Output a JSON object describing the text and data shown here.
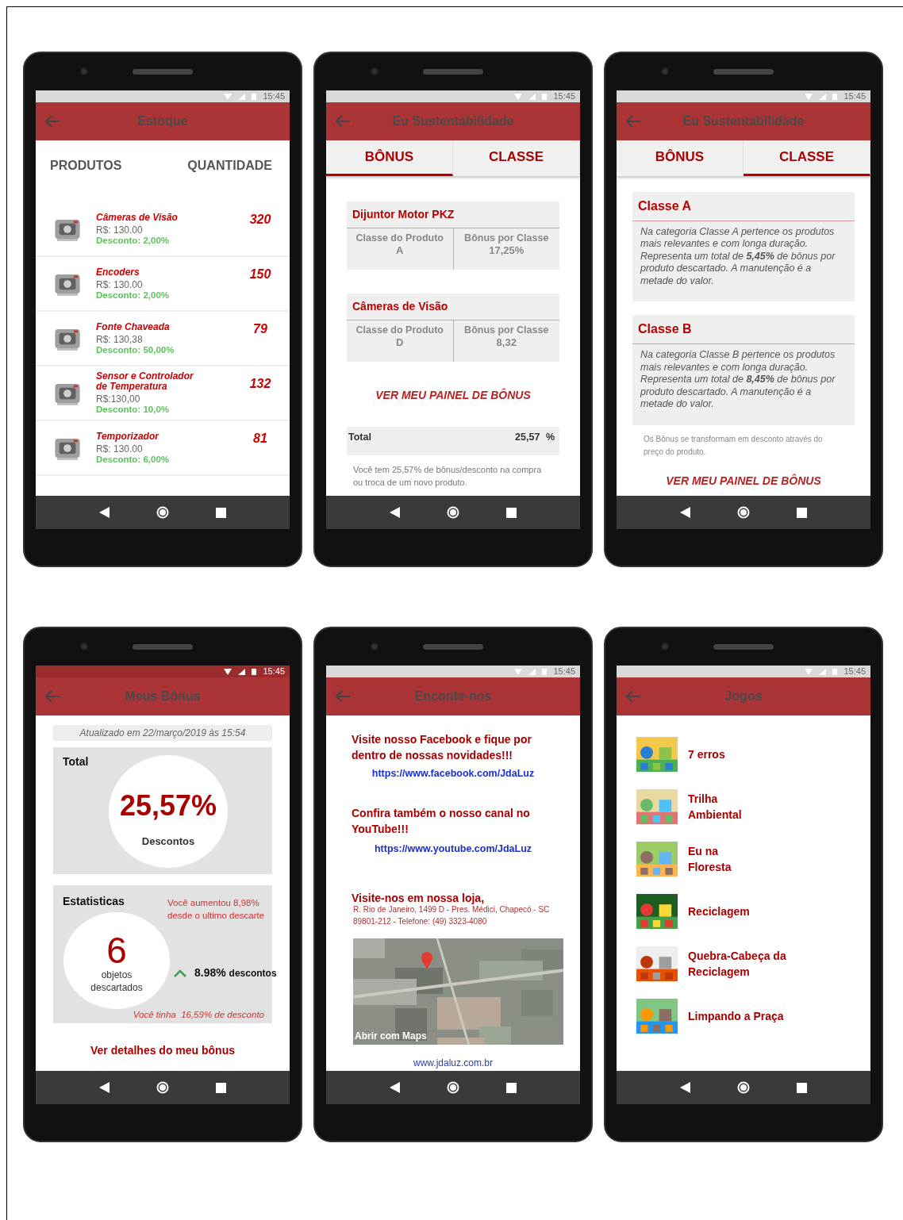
{
  "phones": [
    {
      "kind": "stock",
      "status_bar": {
        "time": "15:45",
        "color": "#d9d9d9"
      },
      "title": "Estoque",
      "columns": [
        "PRODUTOS",
        "QUANTIDADE"
      ],
      "products": [
        {
          "name": "Câmeras de Visão",
          "price": "R$: 130.00",
          "discount": "Desconto: 2,00%",
          "quantity": "320"
        },
        {
          "name": "Encoders",
          "price": "R$: 130.00",
          "discount": "Desconto: 2,00%",
          "quantity": "150"
        },
        {
          "name": "Fonte Chaveada",
          "price": "R$: 130,38",
          "discount": "Desconto: 50,00%",
          "quantity": "79"
        },
        {
          "name": "Sensor e Controlador de Temperatura",
          "price": "R$:130,00",
          "discount": "Desconto: 10,0%",
          "quantity": "132"
        },
        {
          "name": "Temporizador",
          "price": "R$: 130.00",
          "discount": "Desconto: 6,00%",
          "quantity": "81"
        }
      ]
    },
    {
      "kind": "bonus",
      "status_bar": {
        "time": "15:45",
        "color": "#d9d9d9"
      },
      "title": "Eu Sustentabilidade",
      "tabs": [
        {
          "label": "BÔNUS",
          "selected": true
        },
        {
          "label": "CLASSE",
          "selected": false
        }
      ],
      "items": [
        {
          "name": "Dijuntor Motor PKZ",
          "class_label": "Classe do Produto",
          "class_value": "A",
          "bonus_label": "Bônus por Classe",
          "bonus_value": "17,25%"
        },
        {
          "name": "Câmeras de Visão",
          "class_label": "Classe do Produto",
          "class_value": "D",
          "bonus_label": "Bônus por Classe",
          "bonus_value": "8,32"
        }
      ],
      "link": "VER MEU PAINEL DE BÔNUS",
      "total": {
        "label": "Total",
        "value": "25,57",
        "unit": "%"
      },
      "note": "Você tem 25,57% de bônus/desconto na compra ou troca de um novo produto."
    },
    {
      "kind": "classes",
      "status_bar": {
        "time": "15:45",
        "color": "#d9d9d9"
      },
      "title": "Eu Sustentabilidade",
      "tabs": [
        {
          "label": "BÔNUS",
          "selected": false
        },
        {
          "label": "CLASSE",
          "selected": true
        }
      ],
      "classes": [
        {
          "title": "Classe A",
          "text": "Na categoria Classe A  pertence os produtos mais relevantes e com longa duração. Representa um total de **5,45%** de bônus por produto descartado. A manutenção é a metade do valor."
        },
        {
          "title": "Classe B",
          "text": "Na categoria Classe B pertence os produtos mais relevantes e com longa duração. Representa um total de **8,45%** de bônus por produto descartado. A manutenção é a metade do valor."
        }
      ],
      "note": "Os Bônus se transformam em desconto através do preço do produto.",
      "link": "VER MEU PAINEL DE BÔNUS"
    },
    {
      "kind": "my_bonus",
      "status_bar": {
        "time": "15:45",
        "color": "#9a2c2e"
      },
      "title": "Meus Bônus",
      "updated": "Atualizado em 22/março/2019 às 15:54",
      "total": {
        "label": "Total",
        "value": "25,57%",
        "caption": "Descontos"
      },
      "stats": {
        "label": "Estatisticas",
        "change": "Você aumentou 8,98% desde o ultimo descarte",
        "count": "6",
        "count_caption": "objetos descartados",
        "delta": "8.98%",
        "delta_unit": "descontos",
        "previous": "Você tinha  16,59% de desconto"
      },
      "link": "Ver detalhes do meu bônus"
    },
    {
      "kind": "contact",
      "status_bar": {
        "time": "15:45",
        "color": "#d9d9d9"
      },
      "title": "Enconte-nos",
      "facebook_text": "Visite nosso Facebook e fique por dentro de nossas novidades!!!",
      "facebook_url": "https://www.facebook.com/JdaLuz",
      "youtube_text": "Confira também o nosso canal no YouTube!!!",
      "youtube_url": "https://www.youtube.com/JdaLuz",
      "store_title": "Visite-nos em nossa loja,",
      "address": "R. Rio de Janeiro, 1499 D - Pres. Médici, Chapecó - SC 89801-212 - Telefone: (49) 3323-4080",
      "map": {
        "kind": "picture",
        "open_label": "Abrir com Maps"
      },
      "site": "www.jdaluz.com.br"
    },
    {
      "kind": "games",
      "status_bar": {
        "time": "15:45",
        "color": "#d9d9d9"
      },
      "title": "Jogos",
      "games": [
        {
          "name": "7 erros"
        },
        {
          "name": "Trilha\nAmbiental"
        },
        {
          "name": "Eu na\nFloresta"
        },
        {
          "name": "Reciclagem"
        },
        {
          "name": "Quebra-Cabeça da\nReciclagem"
        },
        {
          "name": "Limpando a Praça"
        }
      ]
    }
  ]
}
